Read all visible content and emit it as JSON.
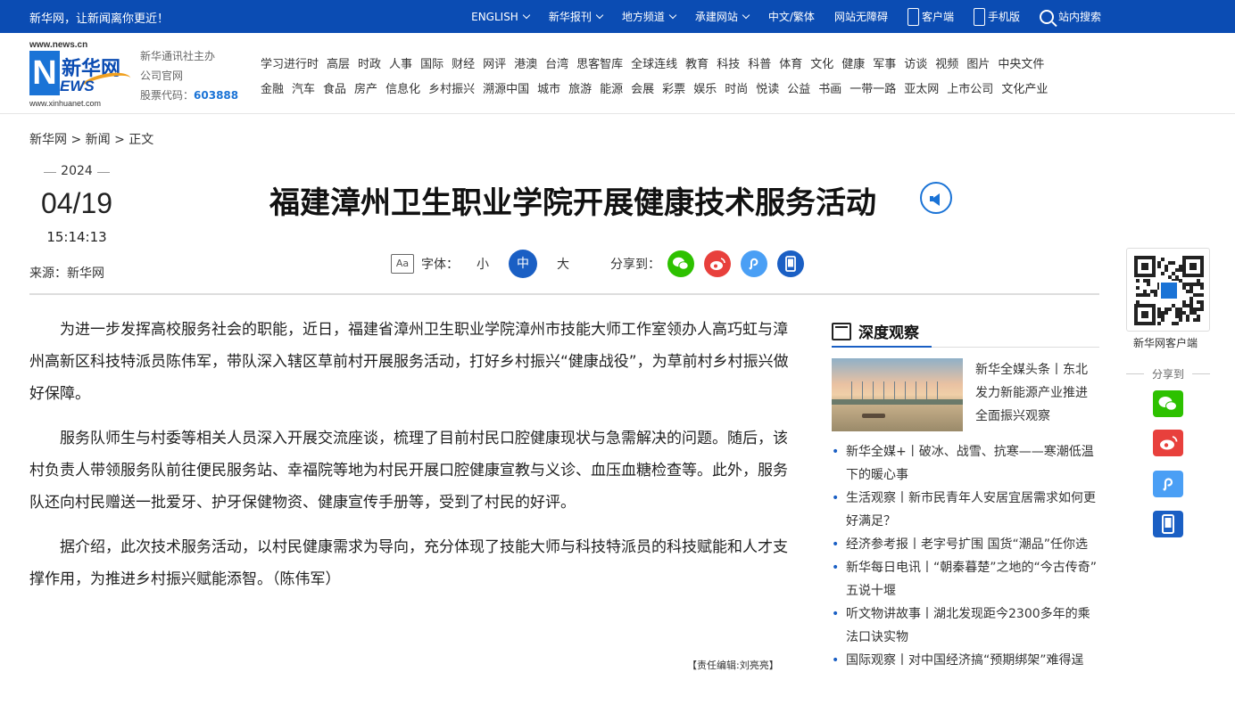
{
  "topbar": {
    "slogan": "新华网，让新闻离你更近！",
    "nav": [
      {
        "label": "ENGLISH",
        "dropdown": true
      },
      {
        "label": "新华报刊",
        "dropdown": true
      },
      {
        "label": "地方频道",
        "dropdown": true
      },
      {
        "label": "承建网站",
        "dropdown": true
      },
      {
        "label": "中文/繁体",
        "dropdown": false
      },
      {
        "label": "网站无障碍",
        "dropdown": false
      },
      {
        "label": "客户端",
        "dropdown": false
      },
      {
        "label": "手机版",
        "dropdown": false
      }
    ],
    "search_label": "站内搜索"
  },
  "header": {
    "logo": {
      "url_top": "www.news.cn",
      "url_bottom": "www.xinhuanet.com",
      "cn": "新华网",
      "mark": "N",
      "ews": "EWS"
    },
    "org_line1": "新华通讯社主办",
    "org_line2": "公司官网",
    "stock_label": "股票代码：",
    "stock_code": "603888",
    "channels_row1": [
      "学习进行时",
      "高层",
      "时政",
      "人事",
      "国际",
      "财经",
      "网评",
      "港澳",
      "台湾",
      "思客智库",
      "全球连线",
      "教育",
      "科技",
      "科普",
      "体育",
      "文化",
      "健康",
      "军事",
      "访谈",
      "视频",
      "图片",
      "中央文件"
    ],
    "channels_row2": [
      "金融",
      "汽车",
      "食品",
      "房产",
      "信息化",
      "乡村振兴",
      "溯源中国",
      "城市",
      "旅游",
      "能源",
      "会展",
      "彩票",
      "娱乐",
      "时尚",
      "悦读",
      "公益",
      "书画",
      "一带一路",
      "亚太网",
      "上市公司",
      "文化产业"
    ]
  },
  "breadcrumb": "新华网 > 新闻 > 正文",
  "date": {
    "year": "2024",
    "month_day": "04/19",
    "time": "15:14:13"
  },
  "source": "来源：新华网",
  "article": {
    "title": "福建漳州卫生职业学院开展健康技术服务活动",
    "font_label": "字体：",
    "font_small": "小",
    "font_medium": "中",
    "font_large": "大",
    "aa_icon_text": "Aa",
    "share_label": "分享到：",
    "paragraphs": [
      "为进一步发挥高校服务社会的职能，近日，福建省漳州卫生职业学院漳州市技能大师工作室领办人高巧虹与漳州高新区科技特派员陈伟军，带队深入辖区草前村开展服务活动，打好乡村振兴“健康战役”，为草前村乡村振兴做好保障。",
      "服务队师生与村委等相关人员深入开展交流座谈，梳理了目前村民口腔健康现状与急需解决的问题。随后，该村负责人带领服务队前往便民服务站、幸福院等地为村民开展口腔健康宣教与义诊、血压血糖检查等。此外，服务队还向村民赠送一批爱牙、护牙保健物资、健康宣传手册等，受到了村民的好评。",
      "据介绍，此次技术服务活动，以村民健康需求为导向，充分体现了技能大师与科技特派员的科技赋能和人才支撑作用，为推进乡村振兴赋能添智。（陈伟军）"
    ],
    "editor": "【责任编辑:刘亮亮】"
  },
  "sidebar": {
    "heading": "深度观察",
    "featured": "新华全媒头条丨东北发力新能源产业推进全面振兴观察",
    "items": [
      "新华全媒+丨破冰、战雪、抗寒——寒潮低温下的暖心事",
      "生活观察丨新市民青年人安居宜居需求如何更好满足？",
      "经济参考报丨老字号扩围 国货“潮品”任你选",
      "新华每日电讯丨“朝秦暮楚”之地的“今古传奇” 五说十堰",
      "听文物讲故事丨湖北发现距今2300多年的乘法口诀实物",
      "国际观察丨对中国经济搞“预期绑架”难得逞"
    ]
  },
  "float": {
    "qr_label": "新华网客户端",
    "share_label": "分享到"
  },
  "colors": {
    "brand_blue": "#0b4cb3",
    "wechat": "#2dc100",
    "weibo": "#e8403c",
    "link": "#4a9ff5",
    "mobile": "#1a5fc4"
  }
}
